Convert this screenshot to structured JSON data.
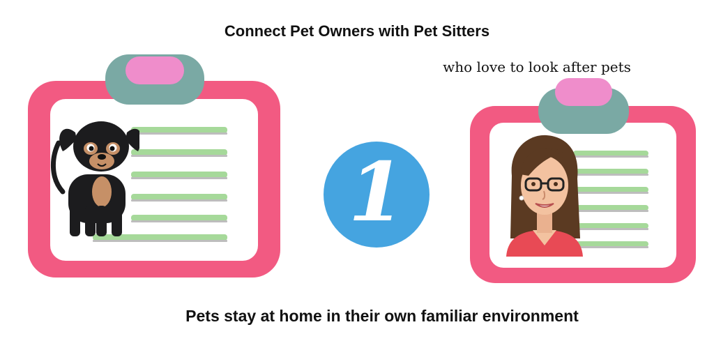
{
  "header": {
    "title": "Connect Pet Owners with Pet Sitters",
    "subtitle": "who love to look after pets"
  },
  "step": {
    "number": "1"
  },
  "footer": {
    "caption": "Pets stay at home in their own familiar environment"
  },
  "icons": {
    "left_card": "clipboard-icon",
    "left_avatar": "dog-icon",
    "right_card": "clipboard-icon",
    "right_avatar": "woman-icon"
  },
  "colors": {
    "clipboard_frame": "#f25a82",
    "clip_base": "#7aa9a4",
    "clip_top": "#ef8dcb",
    "badge": "#45a4e0",
    "lines_green": "#a6d99a"
  }
}
